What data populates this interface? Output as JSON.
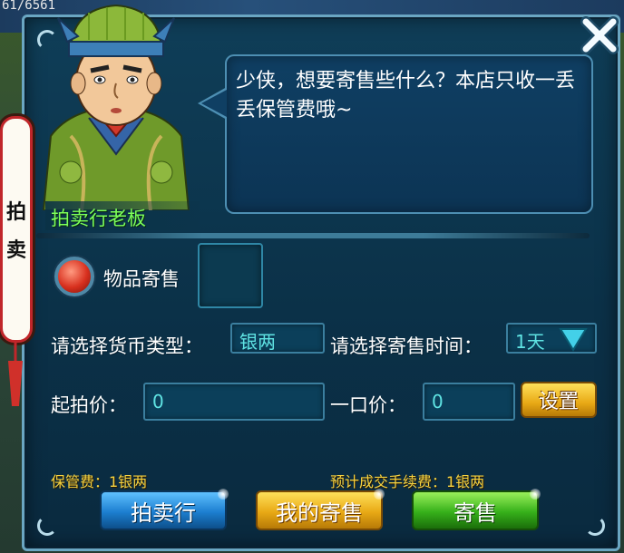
{
  "hud": {
    "hp_text": "61/6561"
  },
  "side_tab": {
    "chars": [
      "拍",
      "卖"
    ]
  },
  "npc": {
    "name": "拍卖行老板",
    "dialogue": "少侠，想要寄售些什么？本店只收一丢丢保管费哦~"
  },
  "consign": {
    "item_label": "物品寄售",
    "currency_label": "请选择货币类型：",
    "currency_value": "银两",
    "time_label": "请选择寄售时间：",
    "time_value": "1天",
    "start_price_label": "起拍价：",
    "start_price_value": "0",
    "buyout_label": "一口价：",
    "buyout_value": "0",
    "set_button": "设置"
  },
  "fees": {
    "storage_fee": "保管费：1银两",
    "trade_fee": "预计成交手续费：1银两"
  },
  "buttons": {
    "auction_house": "拍卖行",
    "my_consignments": "我的寄售",
    "consign": "寄售"
  },
  "colors": {
    "panel_bg": "#0b3148",
    "name_green": "#7cff5a",
    "field_text": "#5fe3e3",
    "fee_yellow": "#f5d342"
  }
}
